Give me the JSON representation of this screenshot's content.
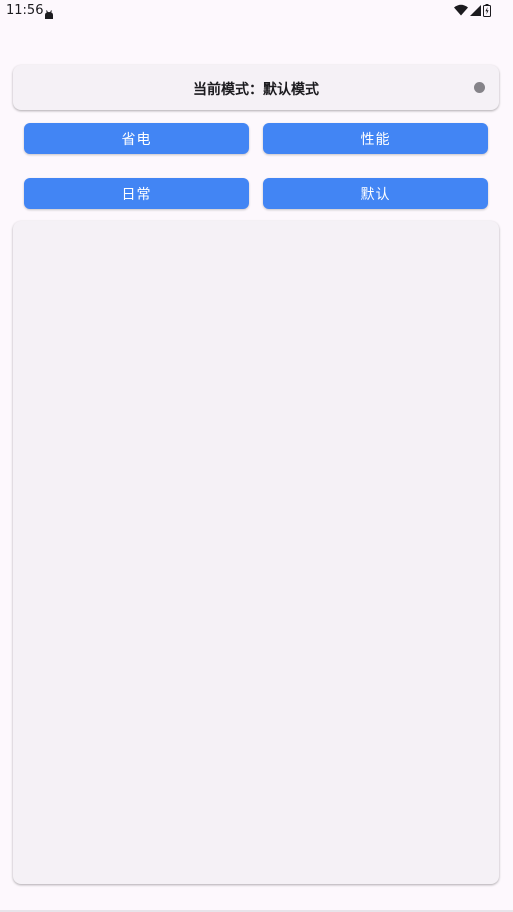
{
  "status_bar": {
    "time": "11:56",
    "icons": [
      "android-notification-icon",
      "wifi-icon",
      "signal-icon",
      "battery-icon"
    ]
  },
  "mode_card": {
    "text": "当前模式：默认模式",
    "indicator_color": "#858389"
  },
  "buttons": {
    "power_save": "省电",
    "performance": "性能",
    "daily": "日常",
    "default": "默认"
  },
  "colors": {
    "background": "#fdf8fd",
    "card": "#f5f1f6",
    "button": "#4285f4",
    "button_text": "#ffffff"
  }
}
